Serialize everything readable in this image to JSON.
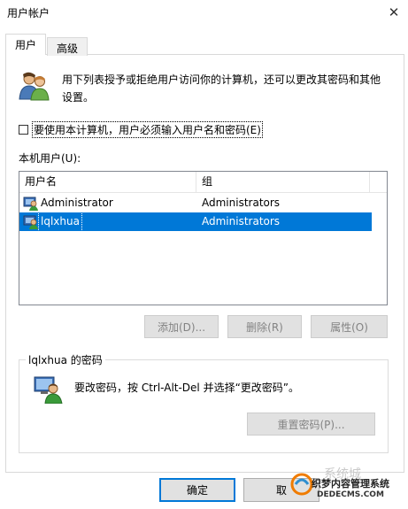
{
  "window": {
    "title": "用户帐户"
  },
  "tabs": [
    {
      "label": "用户"
    },
    {
      "label": "高级"
    }
  ],
  "intro": {
    "text": "用下列表授予或拒绝用户访问你的计算机，还可以更改其密码和其他设置。"
  },
  "require_password": {
    "label": "要使用本计算机，用户必须输入用户名和密码(E)",
    "checked": false
  },
  "local_users": {
    "label": "本机用户(U):",
    "columns": [
      "用户名",
      "组"
    ],
    "rows": [
      {
        "name": "Administrator",
        "group": "Administrators",
        "selected": false
      },
      {
        "name": "lqlxhua",
        "group": "Administrators",
        "selected": true
      }
    ]
  },
  "buttons": {
    "add": "添加(D)...",
    "delete": "删除(R)",
    "properties": "属性(O)"
  },
  "password_group": {
    "legend": "lqlxhua 的密码",
    "text": "要改密码，按 Ctrl-Alt-Del 并选择“更改密码”。",
    "reset_button": "重置密码(P)..."
  },
  "dialog_buttons": {
    "ok": "确定",
    "cancel": "取"
  },
  "watermark": {
    "line1": "织梦内容管理系统",
    "line2": "DEDECMS.COM",
    "line3": "系统城"
  },
  "colors": {
    "selection": "#0078d7",
    "accent": "#0078d7",
    "disabled_text": "#838383"
  },
  "icons": [
    "users-icon",
    "user-row-icon",
    "user-password-icon",
    "close-icon"
  ]
}
